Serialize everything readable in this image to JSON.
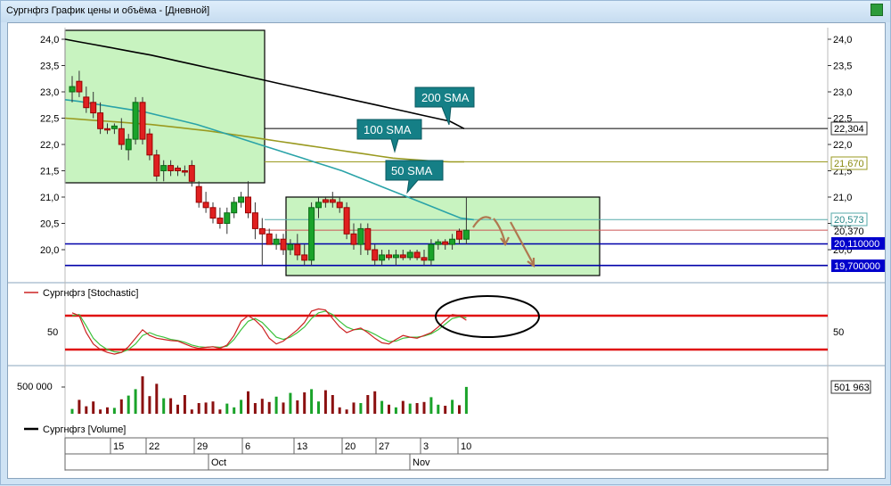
{
  "window": {
    "title": "Сургнфгз График цены и объёма - [Дневной]"
  },
  "price_axis": {
    "ticks_left": [
      "24,0",
      "23,5",
      "23,0",
      "22,5",
      "22,0",
      "21,5",
      "21,0",
      "20,5",
      "20,0"
    ],
    "ticks_right": [
      "24,0",
      "23,5",
      "23,0",
      "22,5",
      "22,0",
      "21,5",
      "21,0",
      "20,5",
      "20,0"
    ],
    "labels": {
      "sma200_value": "22,304",
      "sma100_value": "21,670",
      "sma50_value": "20,573",
      "close_value": "20,370",
      "level_upper": "20,110000",
      "level_lower": "19,700000"
    }
  },
  "callouts": {
    "sma200": "200 SMA",
    "sma100": "100 SMA",
    "sma50": "50 SMA"
  },
  "stochastic": {
    "legend": "Сургнфгз [Stochastic]",
    "tick_left": "50",
    "tick_right": "50"
  },
  "volume": {
    "legend": "Сургнфгз [Volume]",
    "tick_left": "500 000",
    "last_value": "501 963"
  },
  "date_axis": {
    "days": [
      "15",
      "22",
      "29",
      "6",
      "13",
      "20",
      "27",
      "3",
      "10"
    ],
    "months": [
      "Oct",
      "Nov"
    ]
  },
  "chart_data": {
    "type": "candlestick",
    "price_ylim": [
      19.6,
      24.2
    ],
    "candles": [
      {
        "o": 23.0,
        "h": 23.3,
        "l": 22.8,
        "c": 23.1,
        "up": true
      },
      {
        "o": 23.2,
        "h": 23.4,
        "l": 22.9,
        "c": 23.0,
        "up": false
      },
      {
        "o": 22.9,
        "h": 23.1,
        "l": 22.6,
        "c": 22.7,
        "up": false
      },
      {
        "o": 22.8,
        "h": 23.0,
        "l": 22.5,
        "c": 22.6,
        "up": false
      },
      {
        "o": 22.6,
        "h": 22.8,
        "l": 22.2,
        "c": 22.3,
        "up": false
      },
      {
        "o": 22.3,
        "h": 22.4,
        "l": 22.2,
        "c": 22.3,
        "up": false
      },
      {
        "o": 22.3,
        "h": 22.4,
        "l": 22.2,
        "c": 22.35,
        "up": true
      },
      {
        "o": 22.3,
        "h": 22.5,
        "l": 21.9,
        "c": 22.0,
        "up": false
      },
      {
        "o": 21.9,
        "h": 22.2,
        "l": 21.7,
        "c": 22.1,
        "up": true
      },
      {
        "o": 22.1,
        "h": 22.9,
        "l": 22.0,
        "c": 22.8,
        "up": true
      },
      {
        "o": 22.8,
        "h": 22.9,
        "l": 22.0,
        "c": 22.1,
        "up": false
      },
      {
        "o": 22.2,
        "h": 22.3,
        "l": 21.7,
        "c": 21.8,
        "up": false
      },
      {
        "o": 21.8,
        "h": 21.9,
        "l": 21.3,
        "c": 21.4,
        "up": false
      },
      {
        "o": 21.5,
        "h": 21.7,
        "l": 21.3,
        "c": 21.6,
        "up": true
      },
      {
        "o": 21.6,
        "h": 21.7,
        "l": 21.4,
        "c": 21.5,
        "up": false
      },
      {
        "o": 21.5,
        "h": 21.6,
        "l": 21.4,
        "c": 21.55,
        "up": false
      },
      {
        "o": 21.5,
        "h": 21.6,
        "l": 21.4,
        "c": 21.5,
        "up": false
      },
      {
        "o": 21.6,
        "h": 21.7,
        "l": 21.2,
        "c": 21.3,
        "up": false
      },
      {
        "o": 21.2,
        "h": 21.3,
        "l": 20.8,
        "c": 20.9,
        "up": false
      },
      {
        "o": 20.9,
        "h": 21.1,
        "l": 20.7,
        "c": 20.8,
        "up": false
      },
      {
        "o": 20.8,
        "h": 20.9,
        "l": 20.5,
        "c": 20.6,
        "up": false
      },
      {
        "o": 20.6,
        "h": 20.8,
        "l": 20.4,
        "c": 20.5,
        "up": false
      },
      {
        "o": 20.5,
        "h": 20.8,
        "l": 20.3,
        "c": 20.7,
        "up": true
      },
      {
        "o": 20.7,
        "h": 21.0,
        "l": 20.6,
        "c": 20.9,
        "up": true
      },
      {
        "o": 20.9,
        "h": 21.1,
        "l": 20.8,
        "c": 21.0,
        "up": true
      },
      {
        "o": 21.0,
        "h": 21.3,
        "l": 20.6,
        "c": 20.7,
        "up": false
      },
      {
        "o": 20.7,
        "h": 20.9,
        "l": 20.2,
        "c": 20.4,
        "up": false
      },
      {
        "o": 20.4,
        "h": 20.6,
        "l": 19.7,
        "c": 20.3,
        "up": false
      },
      {
        "o": 20.3,
        "h": 20.4,
        "l": 20.1,
        "c": 20.1,
        "up": false
      },
      {
        "o": 20.1,
        "h": 20.3,
        "l": 20.0,
        "c": 20.2,
        "up": true
      },
      {
        "o": 20.2,
        "h": 20.3,
        "l": 19.9,
        "c": 20.0,
        "up": false
      },
      {
        "o": 20.0,
        "h": 20.2,
        "l": 19.9,
        "c": 20.1,
        "up": true
      },
      {
        "o": 20.1,
        "h": 20.3,
        "l": 19.8,
        "c": 19.9,
        "up": false
      },
      {
        "o": 19.9,
        "h": 20.1,
        "l": 19.7,
        "c": 19.8,
        "up": false
      },
      {
        "o": 19.8,
        "h": 20.9,
        "l": 19.7,
        "c": 20.8,
        "up": true
      },
      {
        "o": 20.8,
        "h": 21.0,
        "l": 20.6,
        "c": 20.9,
        "up": true
      },
      {
        "o": 20.9,
        "h": 21.0,
        "l": 20.8,
        "c": 20.95,
        "up": false
      },
      {
        "o": 20.95,
        "h": 21.1,
        "l": 20.8,
        "c": 20.9,
        "up": false
      },
      {
        "o": 20.9,
        "h": 21.0,
        "l": 20.7,
        "c": 20.8,
        "up": false
      },
      {
        "o": 20.8,
        "h": 20.9,
        "l": 20.2,
        "c": 20.3,
        "up": false
      },
      {
        "o": 20.3,
        "h": 20.5,
        "l": 20.0,
        "c": 20.1,
        "up": false
      },
      {
        "o": 20.1,
        "h": 20.5,
        "l": 19.9,
        "c": 20.4,
        "up": true
      },
      {
        "o": 20.4,
        "h": 20.5,
        "l": 19.9,
        "c": 20.0,
        "up": false
      },
      {
        "o": 20.0,
        "h": 20.1,
        "l": 19.7,
        "c": 19.8,
        "up": false
      },
      {
        "o": 19.8,
        "h": 20.0,
        "l": 19.7,
        "c": 19.9,
        "up": true
      },
      {
        "o": 19.9,
        "h": 20.0,
        "l": 19.8,
        "c": 19.85,
        "up": false
      },
      {
        "o": 19.85,
        "h": 20.0,
        "l": 19.7,
        "c": 19.9,
        "up": true
      },
      {
        "o": 19.9,
        "h": 20.0,
        "l": 19.8,
        "c": 19.85,
        "up": false
      },
      {
        "o": 19.85,
        "h": 20.0,
        "l": 19.8,
        "c": 19.95,
        "up": true
      },
      {
        "o": 19.95,
        "h": 20.0,
        "l": 19.8,
        "c": 19.85,
        "up": false
      },
      {
        "o": 19.85,
        "h": 20.0,
        "l": 19.7,
        "c": 19.8,
        "up": false
      },
      {
        "o": 19.8,
        "h": 20.2,
        "l": 19.7,
        "c": 20.1,
        "up": true
      },
      {
        "o": 20.1,
        "h": 20.2,
        "l": 20.0,
        "c": 20.15,
        "up": true
      },
      {
        "o": 20.15,
        "h": 20.2,
        "l": 20.0,
        "c": 20.1,
        "up": false
      },
      {
        "o": 20.1,
        "h": 20.3,
        "l": 20.0,
        "c": 20.2,
        "up": true
      },
      {
        "o": 20.2,
        "h": 20.4,
        "l": 20.1,
        "c": 20.35,
        "up": false
      },
      {
        "o": 20.2,
        "h": 21.0,
        "l": 20.1,
        "c": 20.37,
        "up": true
      }
    ],
    "volume_ylim": [
      0,
      700000
    ],
    "volume": [
      90000,
      260000,
      140000,
      230000,
      80000,
      120000,
      110000,
      270000,
      340000,
      460000,
      700000,
      330000,
      560000,
      290000,
      290000,
      170000,
      350000,
      80000,
      200000,
      210000,
      230000,
      80000,
      190000,
      120000,
      260000,
      420000,
      200000,
      280000,
      220000,
      320000,
      210000,
      390000,
      250000,
      400000,
      460000,
      230000,
      440000,
      350000,
      120000,
      80000,
      210000,
      200000,
      350000,
      420000,
      240000,
      170000,
      120000,
      240000,
      190000,
      200000,
      220000,
      310000,
      170000,
      150000,
      260000,
      160000,
      501963
    ],
    "vol_up": [
      true,
      false,
      false,
      false,
      false,
      false,
      true,
      false,
      true,
      true,
      false,
      false,
      false,
      true,
      false,
      false,
      false,
      false,
      false,
      false,
      false,
      false,
      true,
      true,
      true,
      false,
      false,
      false,
      false,
      true,
      false,
      true,
      false,
      false,
      true,
      true,
      false,
      false,
      false,
      false,
      false,
      true,
      false,
      false,
      true,
      false,
      true,
      false,
      true,
      false,
      false,
      true,
      true,
      false,
      true,
      false,
      true
    ],
    "stoch_ylim": [
      0,
      100
    ],
    "stoch_k": [
      85,
      80,
      50,
      30,
      20,
      15,
      12,
      15,
      25,
      40,
      55,
      45,
      40,
      38,
      36,
      35,
      30,
      25,
      22,
      24,
      25,
      22,
      28,
      45,
      70,
      80,
      72,
      60,
      40,
      30,
      35,
      45,
      55,
      68,
      88,
      92,
      90,
      75,
      60,
      50,
      55,
      58,
      50,
      40,
      32,
      30,
      38,
      45,
      42,
      40,
      45,
      50,
      60,
      72,
      82,
      80,
      72
    ],
    "stoch_d": [
      80,
      82,
      62,
      40,
      28,
      20,
      16,
      15,
      20,
      30,
      45,
      50,
      45,
      42,
      38,
      36,
      33,
      28,
      25,
      24,
      25,
      24,
      26,
      38,
      55,
      70,
      75,
      68,
      55,
      42,
      38,
      42,
      50,
      60,
      75,
      85,
      88,
      82,
      70,
      60,
      55,
      56,
      53,
      47,
      40,
      34,
      35,
      40,
      42,
      42,
      44,
      48,
      55,
      65,
      75,
      78,
      76
    ],
    "stoch_levels": [
      80,
      20
    ],
    "sma200": [
      24.0,
      23.95,
      23.9,
      23.85,
      23.8,
      23.75,
      23.7,
      23.64,
      23.58,
      23.52,
      23.46,
      23.4,
      23.34,
      23.28,
      23.22,
      23.16,
      23.1,
      23.04,
      22.98,
      22.92,
      22.86,
      22.8,
      22.74,
      22.68,
      22.62,
      22.56,
      22.5,
      22.44,
      22.3
    ],
    "sma100": [
      22.5,
      22.48,
      22.46,
      22.44,
      22.42,
      22.4,
      22.38,
      22.35,
      22.32,
      22.29,
      22.26,
      22.22,
      22.18,
      22.14,
      22.1,
      22.06,
      22.02,
      21.98,
      21.94,
      21.9,
      21.86,
      21.82,
      21.78,
      21.74,
      21.72,
      21.7,
      21.68,
      21.67,
      21.67
    ],
    "sma50": [
      22.85,
      22.82,
      22.78,
      22.74,
      22.7,
      22.66,
      22.62,
      22.56,
      22.5,
      22.44,
      22.38,
      22.3,
      22.22,
      22.14,
      22.06,
      21.98,
      21.9,
      21.82,
      21.74,
      21.66,
      21.58,
      21.5,
      21.4,
      21.3,
      21.2,
      21.1,
      21.0,
      20.9,
      20.8,
      20.7,
      20.6,
      20.57
    ],
    "hlines": [
      {
        "y": 22.304,
        "color": "#000000"
      },
      {
        "y": 21.67,
        "color": "#9a9a20"
      },
      {
        "y": 20.573,
        "color": "#55aaaa"
      },
      {
        "y": 20.37,
        "color": "#cc5555"
      },
      {
        "y": 20.11,
        "color": "#0000aa"
      },
      {
        "y": 19.7,
        "color": "#0000aa"
      }
    ]
  }
}
